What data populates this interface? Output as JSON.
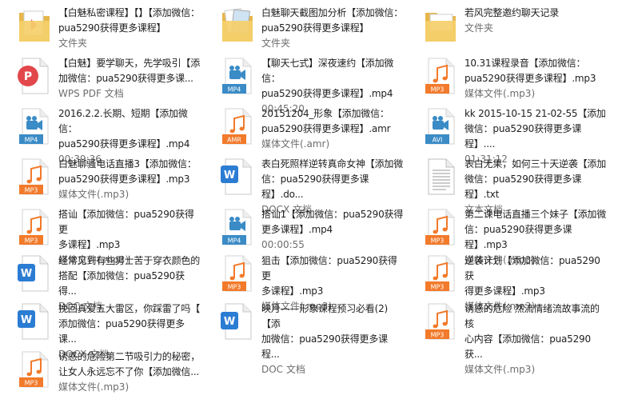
{
  "files": [
    {
      "icon": "folder-docs",
      "name": "【白魅私密课程】【】【添加微信：\npua5290获得更多课程】",
      "sub": "文件夹"
    },
    {
      "icon": "folder-images",
      "name": "白魅聊天截图加分析【添加微信：\npua5290获得更多课程】",
      "sub": "文件夹"
    },
    {
      "icon": "folder-plain",
      "name": "若风完整邀约聊天记录",
      "sub": "文件夹"
    },
    {
      "icon": "pdf",
      "name": "【白魅】要学聊天，先学吸引【添\n加微信：pua5290获得更多课...",
      "sub": "WPS PDF 文档"
    },
    {
      "icon": "video",
      "tag": "MP4",
      "name": "【聊天七式】深夜速约【添加微信：\npua5290获得更多课程】.mp4",
      "sub": "00:45:20"
    },
    {
      "icon": "audio",
      "tag": "MP3",
      "name": "10.31课程录音【添加微信：\npua5290获得更多课程】.mp3",
      "sub": "媒体文件(.mp3)"
    },
    {
      "icon": "video",
      "tag": "MP4",
      "name": "2016.2.2.长期、短期【添加微信：\npua5290获得更多课程】.mp4",
      "sub": "00:39:36"
    },
    {
      "icon": "audio",
      "tag": "AMR",
      "name": "20151204_形象【添加微信：\npua5290获得更多课程】.amr",
      "sub": "媒体文件(.amr)"
    },
    {
      "icon": "video",
      "tag": "AVI",
      "name": "kk 2015-10-15 21-02-55【添加\n微信：pua5290获得更多课程】....",
      "sub": "01:31:12"
    },
    {
      "icon": "audio",
      "tag": "MP3",
      "name": "白魅聊骚电话直播3【添加微信：\npua5290获得更多课程】.mp3",
      "sub": "媒体文件(.mp3)"
    },
    {
      "icon": "docx",
      "name": "表白死照样逆转真命女神【添加微\n信：pua5290获得更多课程】.do...",
      "sub": "DOCX 文档"
    },
    {
      "icon": "txt",
      "name": "表白无果，如何三十天逆袭【添加\n微信：pua5290获得更多课程】.txt",
      "sub": "文本文档"
    },
    {
      "icon": "audio",
      "tag": "MP3",
      "name": "搭讪【添加微信：pua5290获得更\n多课程】.mp3",
      "sub": "媒体文件(.mp3)"
    },
    {
      "icon": "video",
      "tag": "MP4",
      "name": "搭讪1【添加微信：pua5290获得\n更多课程】.mp4",
      "sub": "00:00:55"
    },
    {
      "icon": "audio",
      "tag": "MP3",
      "name": "第二课电话直播三个妹子【添加微\n信：pua5290获得更多课程】.mp3",
      "sub": "媒体文件(.mp3)"
    },
    {
      "icon": "doc",
      "name": "经常见到有些男士苦于穿衣颜色的\n搭配【添加微信：pua5290获得...",
      "sub": "DOC 文档"
    },
    {
      "icon": "audio",
      "tag": "MP3",
      "name": "狙击【添加微信：pua5290获得更\n多课程】.mp3",
      "sub": "媒体文件(.mp3)"
    },
    {
      "icon": "audio",
      "tag": "MP3",
      "name": "逆袭计划【添加微信：pua5290获\n得更多课程】.mp3",
      "sub": "媒体文件(.mp3)"
    },
    {
      "icon": "docx",
      "name": "挽回真爱五大雷区，你踩雷了吗【\n添加微信：pua5290获得更多课...",
      "sub": "DOCX 文档"
    },
    {
      "icon": "doc",
      "name": "映月——形象课程预习必看(2)【添\n加微信：pua5290获得更多课程...",
      "sub": "DOC 文档"
    },
    {
      "icon": "audio",
      "tag": "MP3",
      "name": "诱惑的危险 然流情绪流故事流的核\n心内容【添加微信：pua5290获...",
      "sub": "媒体文件(.mp3)"
    },
    {
      "icon": "audio",
      "tag": "MP3",
      "name": "诱惑的危险第二节吸引力的秘密，\n让女人永远忘不了你【添加微信...",
      "sub": "媒体文件(.mp3)"
    }
  ],
  "colors": {
    "audio_accent": "#f27a2b",
    "video_accent": "#3a8bc6",
    "word_accent": "#2b7cd3",
    "pdf_accent": "#e2474b",
    "folder": "#f5cf6a"
  }
}
